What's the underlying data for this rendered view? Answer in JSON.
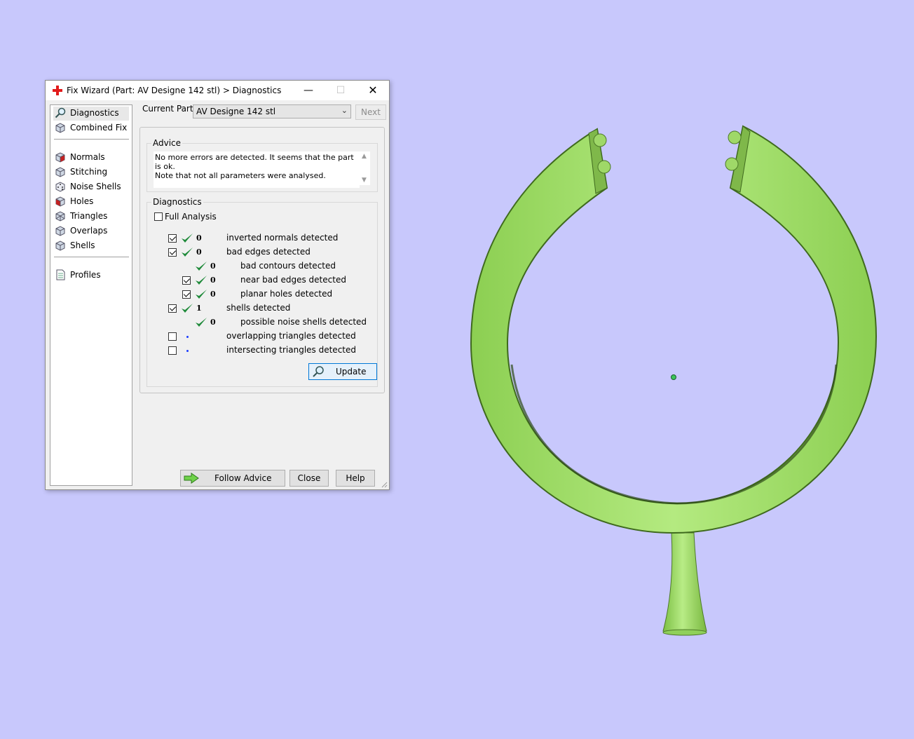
{
  "window": {
    "title": "Fix Wizard (Part: AV Designe 142 stl) > Diagnostics",
    "minimize_glyph": "—",
    "maximize_glyph": "☐",
    "close_glyph": "✕"
  },
  "nav": {
    "items": [
      {
        "label": "Diagnostics",
        "icon": "magnifier-icon",
        "selected": true
      },
      {
        "label": "Combined Fix",
        "icon": "cube-icon"
      },
      {
        "label": "Normals",
        "icon": "cube-red-icon"
      },
      {
        "label": "Stitching",
        "icon": "cube-icon"
      },
      {
        "label": "Noise Shells",
        "icon": "dice-icon"
      },
      {
        "label": "Holes",
        "icon": "cube-red-icon"
      },
      {
        "label": "Triangles",
        "icon": "triangle-icon"
      },
      {
        "label": "Overlaps",
        "icon": "cube-icon"
      },
      {
        "label": "Shells",
        "icon": "cube-icon"
      },
      {
        "label": "Profiles",
        "icon": "document-icon"
      }
    ]
  },
  "current_part": {
    "label": "Current Part:",
    "value": "AV Designe 142 stl",
    "next_label": "Next"
  },
  "advice": {
    "title": "Advice",
    "text_line1": "No more errors are detected. It seems that the part is ok.",
    "text_line2": "Note that not all parameters were analysed."
  },
  "diagnostics": {
    "title": "Diagnostics",
    "full_analysis_label": "Full Analysis",
    "full_analysis_checked": false,
    "rows": [
      {
        "label": "inverted normals detected",
        "count": "0",
        "checked": true,
        "status": "ok",
        "indent": 0
      },
      {
        "label": "bad edges detected",
        "count": "0",
        "checked": true,
        "status": "ok",
        "indent": 0
      },
      {
        "label": "bad contours detected",
        "count": "0",
        "checked": null,
        "status": "ok",
        "indent": 1
      },
      {
        "label": "near bad edges detected",
        "count": "0",
        "checked": true,
        "status": "ok",
        "indent": 1
      },
      {
        "label": "planar holes detected",
        "count": "0",
        "checked": true,
        "status": "ok",
        "indent": 1
      },
      {
        "label": "shells detected",
        "count": "1",
        "checked": true,
        "status": "ok",
        "indent": 0
      },
      {
        "label": "possible noise shells detected",
        "count": "0",
        "checked": null,
        "status": "ok",
        "indent": 1
      },
      {
        "label": "overlapping triangles detected",
        "count": "",
        "checked": false,
        "status": "pending",
        "indent": 0
      },
      {
        "label": "intersecting triangles detected",
        "count": "",
        "checked": false,
        "status": "pending",
        "indent": 0
      }
    ],
    "update_label": "Update"
  },
  "buttons": {
    "follow_advice": "Follow Advice",
    "close": "Close",
    "help": "Help"
  },
  "colors": {
    "viewport_bg": "#c8c8fc",
    "model_green": "#a6e070",
    "check_green": "#1f8a3a",
    "accent_blue": "#0078d7"
  }
}
